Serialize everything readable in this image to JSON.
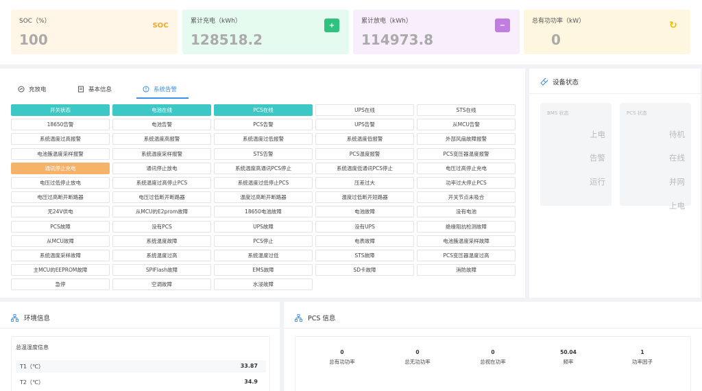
{
  "cards": [
    {
      "label": "SOC（%）",
      "value": "100",
      "icon": "soc-icon",
      "icon_text": "SOC",
      "bg": "#fff6e8",
      "icon_bg": "#fff6e8",
      "icon_color": "#f5a623"
    },
    {
      "label": "累计充电（kWh）",
      "value": "128518.2",
      "icon": "battery-charge-icon",
      "icon_text": "+",
      "bg": "#e6fbef",
      "icon_bg": "#2ec27e",
      "icon_color": "#ffffff"
    },
    {
      "label": "累计放电（kWh）",
      "value": "114973.8",
      "icon": "battery-discharge-icon",
      "icon_text": "−",
      "bg": "#f9eefc",
      "icon_bg": "#c07ee0",
      "icon_color": "#ffffff"
    },
    {
      "label": "总有功功率（kW）",
      "value": "0",
      "icon": "refresh-icon",
      "icon_text": "↻",
      "bg": "#fff6e0",
      "icon_bg": "#fff6e0",
      "icon_color": "#f5b800"
    }
  ],
  "tabs": [
    {
      "label": "充放电",
      "icon": "gauge-icon",
      "active": false
    },
    {
      "label": "基本信息",
      "icon": "document-icon",
      "active": false
    },
    {
      "label": "系统告警",
      "icon": "alert-circle-icon",
      "active": true
    }
  ],
  "alarm_cells": [
    {
      "label": "开关状态",
      "state": "on"
    },
    {
      "label": "电池在线",
      "state": "on"
    },
    {
      "label": "PCS在线",
      "state": "on"
    },
    {
      "label": "UPS在线",
      "state": ""
    },
    {
      "label": "STS在线",
      "state": ""
    },
    {
      "label": "18650告警",
      "state": ""
    },
    {
      "label": "电池告警",
      "state": ""
    },
    {
      "label": "PCS告警",
      "state": ""
    },
    {
      "label": "UPS告警",
      "state": ""
    },
    {
      "label": "从MCU告警",
      "state": ""
    },
    {
      "label": "系统温度过高报警",
      "state": ""
    },
    {
      "label": "系统温度高报警",
      "state": ""
    },
    {
      "label": "系统温度过低报警",
      "state": ""
    },
    {
      "label": "系统温度低报警",
      "state": ""
    },
    {
      "label": "外部风扇故障报警",
      "state": ""
    },
    {
      "label": "电池簇温度采样报警",
      "state": ""
    },
    {
      "label": "系统温度采样报警",
      "state": ""
    },
    {
      "label": "STS告警",
      "state": ""
    },
    {
      "label": "PCS温度报警",
      "state": ""
    },
    {
      "label": "PCS变压器温度报警",
      "state": ""
    },
    {
      "label": "通讯停止充电",
      "state": "warn"
    },
    {
      "label": "通讯停止放电",
      "state": ""
    },
    {
      "label": "系统温度高通讯PCS停止",
      "state": ""
    },
    {
      "label": "系统温度低通讯PCS停止",
      "state": ""
    },
    {
      "label": "电压过高停止充电",
      "state": ""
    },
    {
      "label": "电压过低停止放电",
      "state": ""
    },
    {
      "label": "系统温度过高停止PCS",
      "state": ""
    },
    {
      "label": "系统温度过低停止PCS",
      "state": ""
    },
    {
      "label": "压差过大",
      "state": ""
    },
    {
      "label": "功率过大停止PCS",
      "state": ""
    },
    {
      "label": "电压过高断开断路器",
      "state": ""
    },
    {
      "label": "电压过低断开断路器",
      "state": ""
    },
    {
      "label": "温度过高断开断路器",
      "state": ""
    },
    {
      "label": "温度过低断开短路器",
      "state": ""
    },
    {
      "label": "开关节点未吸合",
      "state": ""
    },
    {
      "label": "无24V供电",
      "state": ""
    },
    {
      "label": "从MCU的E2prom故障",
      "state": ""
    },
    {
      "label": "18650电池故障",
      "state": ""
    },
    {
      "label": "电池故障",
      "state": ""
    },
    {
      "label": "没有电池",
      "state": ""
    },
    {
      "label": "PCS故障",
      "state": ""
    },
    {
      "label": "没有PCS",
      "state": ""
    },
    {
      "label": "UPS故障",
      "state": ""
    },
    {
      "label": "没有UPS",
      "state": ""
    },
    {
      "label": "绝缘阻抗检测故障",
      "state": ""
    },
    {
      "label": "从MCU故障",
      "state": ""
    },
    {
      "label": "系统温度故障",
      "state": ""
    },
    {
      "label": "PCS停止",
      "state": ""
    },
    {
      "label": "电表故障",
      "state": ""
    },
    {
      "label": "电池簇温度采样故障",
      "state": ""
    },
    {
      "label": "系统温度采样故障",
      "state": ""
    },
    {
      "label": "系统温度过高",
      "state": ""
    },
    {
      "label": "系统温度过低",
      "state": ""
    },
    {
      "label": "STS故障",
      "state": ""
    },
    {
      "label": "PCS变压器温度过高",
      "state": ""
    },
    {
      "label": "主MCU的EEPROM故障",
      "state": ""
    },
    {
      "label": "SPIFlash故障",
      "state": ""
    },
    {
      "label": "EMS故障",
      "state": ""
    },
    {
      "label": "SD卡故障",
      "state": ""
    },
    {
      "label": "消防故障",
      "state": ""
    },
    {
      "label": "急停",
      "state": ""
    },
    {
      "label": "空调故障",
      "state": ""
    },
    {
      "label": "水浸故障",
      "state": ""
    }
  ],
  "device_status": {
    "title": "设备状态",
    "bms": {
      "title": "BMS 状态",
      "items": [
        "上电",
        "告警",
        "运行"
      ]
    },
    "pcs": {
      "title": "PCS 状态",
      "items": [
        "待机",
        "在线",
        "并网",
        "上电"
      ]
    }
  },
  "env": {
    "title": "环境信息",
    "box_title": "总温湿度信息",
    "rows": [
      {
        "label": "T1（℃）",
        "value": "33.87"
      },
      {
        "label": "T2（℃）",
        "value": "34.9"
      }
    ]
  },
  "pcs_info": {
    "title": "PCS 信息",
    "items": [
      {
        "value": "0",
        "label": "总有功功率"
      },
      {
        "value": "0",
        "label": "总无功功率"
      },
      {
        "value": "0",
        "label": "总视在功率"
      },
      {
        "value": "50.04",
        "label": "频率"
      },
      {
        "value": "1",
        "label": "功率因子"
      }
    ]
  },
  "colors": {
    "accent": "#3a8ee6",
    "on": "#3cc9c5",
    "warn": "#f7b26a"
  }
}
